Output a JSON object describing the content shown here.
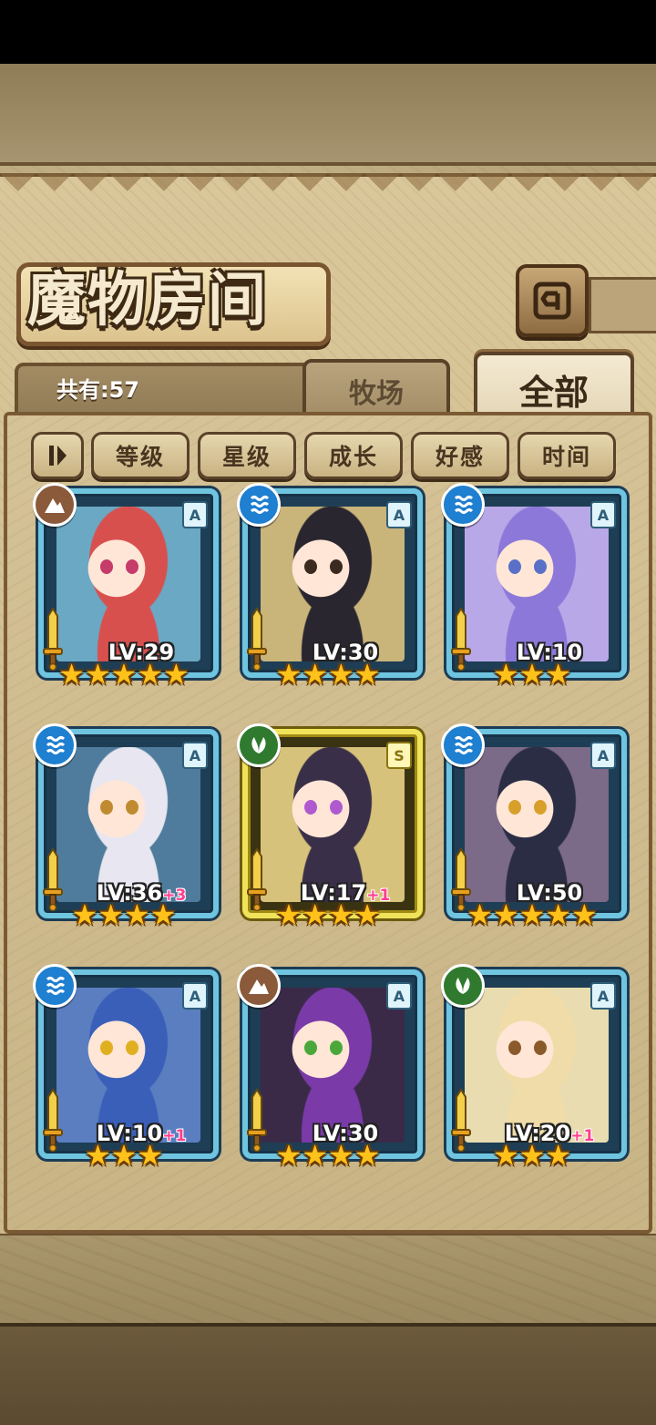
{
  "header": {
    "title": "魔物房间",
    "back_icon": "back-arrow-icon"
  },
  "summary": {
    "count_text": "共有:57"
  },
  "tabs": [
    {
      "label": "牧场",
      "active": false
    },
    {
      "label": "全部",
      "active": true
    }
  ],
  "sort": {
    "toggle_icon": "sort-order-icon",
    "buttons": [
      {
        "label": "等级"
      },
      {
        "label": "星级"
      },
      {
        "label": "成长"
      },
      {
        "label": "好感"
      },
      {
        "label": "时间"
      }
    ]
  },
  "monsters": [
    {
      "lv": "LV:29",
      "plus": "",
      "element": "earth",
      "rank": "A",
      "stars": 5,
      "frame": "blue",
      "hair": "#d8504e",
      "eye": "#c53b6a",
      "bg": "#6aa8c4"
    },
    {
      "lv": "LV:30",
      "plus": "",
      "element": "water",
      "rank": "A",
      "stars": 4,
      "frame": "blue",
      "hair": "#2a2630",
      "eye": "#3a2a20",
      "bg": "#c9b47a"
    },
    {
      "lv": "LV:10",
      "plus": "",
      "element": "water",
      "rank": "A",
      "stars": 3,
      "frame": "blue",
      "hair": "#8c78d8",
      "eye": "#5a70c8",
      "bg": "#b9a8e8"
    },
    {
      "lv": "LV:36",
      "plus": "+3",
      "element": "water",
      "rank": "A",
      "stars": 4,
      "frame": "blue",
      "hair": "#e8e6f0",
      "eye": "#c08a30",
      "bg": "#4f7c9c"
    },
    {
      "lv": "LV:17",
      "plus": "+1",
      "element": "nature",
      "rank": "S",
      "stars": 4,
      "frame": "gold",
      "hair": "#3a2f48",
      "eye": "#b05ad0",
      "bg": "#d6c27a"
    },
    {
      "lv": "LV:50",
      "plus": "",
      "element": "water",
      "rank": "A",
      "stars": 5,
      "frame": "blue",
      "hair": "#2b2d44",
      "eye": "#d8a02a",
      "bg": "#7b6a88"
    },
    {
      "lv": "LV:10",
      "plus": "+1",
      "element": "water",
      "rank": "A",
      "stars": 3,
      "frame": "blue",
      "hair": "#3a5fb8",
      "eye": "#e0b020",
      "bg": "#5a7ec0"
    },
    {
      "lv": "LV:30",
      "plus": "",
      "element": "earth",
      "rank": "A",
      "stars": 4,
      "frame": "blue",
      "hair": "#7a3aa8",
      "eye": "#4aa83a",
      "bg": "#3a2a48"
    },
    {
      "lv": "LV:20",
      "plus": "+1",
      "element": "nature",
      "rank": "A",
      "stars": 3,
      "frame": "blue",
      "hair": "#f0dca8",
      "eye": "#8a5a2a",
      "bg": "#e8dcb0"
    }
  ]
}
